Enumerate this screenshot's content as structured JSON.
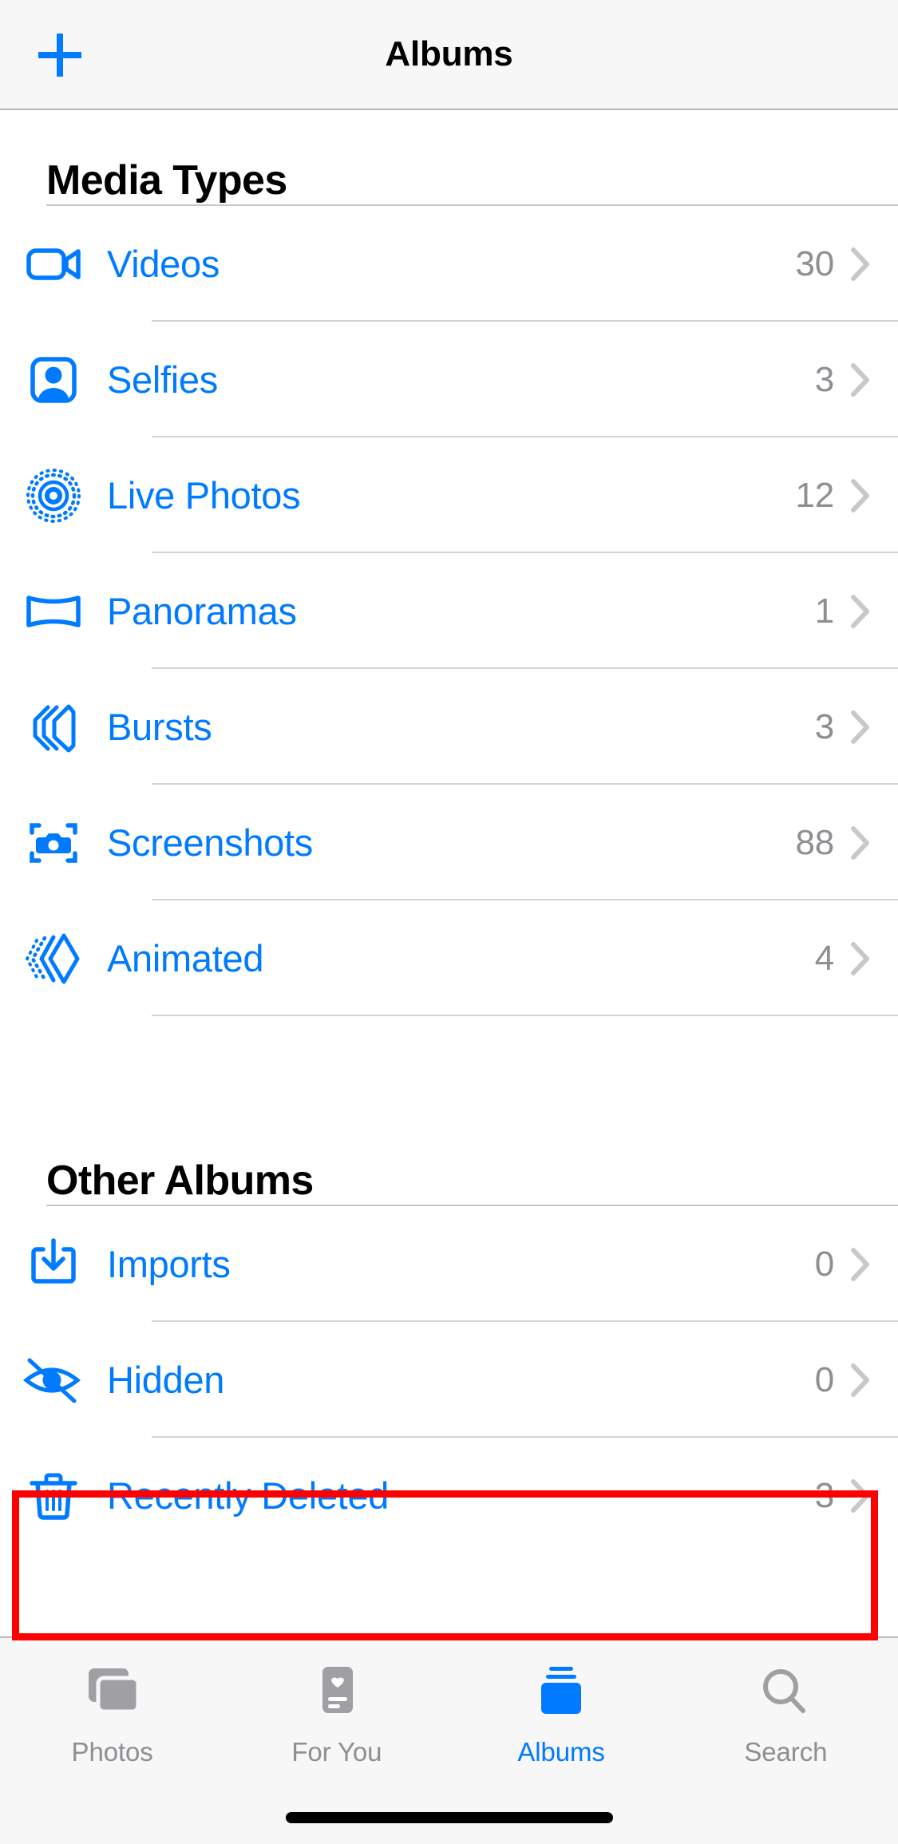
{
  "navbar": {
    "title": "Albums",
    "add_button_label": "+",
    "add_icon": "plus-icon",
    "accent_color": "#007AFF"
  },
  "sections": [
    {
      "title": "Media Types",
      "rows": [
        {
          "icon": "video-camera-icon",
          "label": "Videos",
          "count": "30"
        },
        {
          "icon": "person-portrait-icon",
          "label": "Selfies",
          "count": "3"
        },
        {
          "icon": "live-photo-icon",
          "label": "Live Photos",
          "count": "12"
        },
        {
          "icon": "panorama-icon",
          "label": "Panoramas",
          "count": "1"
        },
        {
          "icon": "burst-stack-icon",
          "label": "Bursts",
          "count": "3"
        },
        {
          "icon": "screenshot-icon",
          "label": "Screenshots",
          "count": "88"
        },
        {
          "icon": "animated-icon",
          "label": "Animated",
          "count": "4"
        }
      ]
    },
    {
      "title": "Other Albums",
      "rows": [
        {
          "icon": "import-tray-icon",
          "label": "Imports",
          "count": "0"
        },
        {
          "icon": "eye-slash-icon",
          "label": "Hidden",
          "count": "0"
        },
        {
          "icon": "trash-icon",
          "label": "Recently Deleted",
          "count": "3",
          "highlighted": true
        }
      ]
    }
  ],
  "chevron_icon": "chevron-right-icon",
  "highlight": {
    "target": "Recently Deleted",
    "color": "#FF0000"
  },
  "tabbar": {
    "active": "Albums",
    "tabs": [
      {
        "icon": "photos-stack-icon",
        "label": "Photos",
        "active": false
      },
      {
        "icon": "for-you-card-icon",
        "label": "For You",
        "active": false
      },
      {
        "icon": "albums-stack-icon",
        "label": "Albums",
        "active": true
      },
      {
        "icon": "magnifier-icon",
        "label": "Search",
        "active": false
      }
    ]
  },
  "colors": {
    "accent": "#007AFF",
    "label_blue": "#007AFF",
    "count_gray": "#8E8E93",
    "chevron_gray": "#C7C7CC",
    "separator": "#D4D3D8",
    "bar_background": "#F7F7F7",
    "highlight_red": "#FF0000"
  }
}
